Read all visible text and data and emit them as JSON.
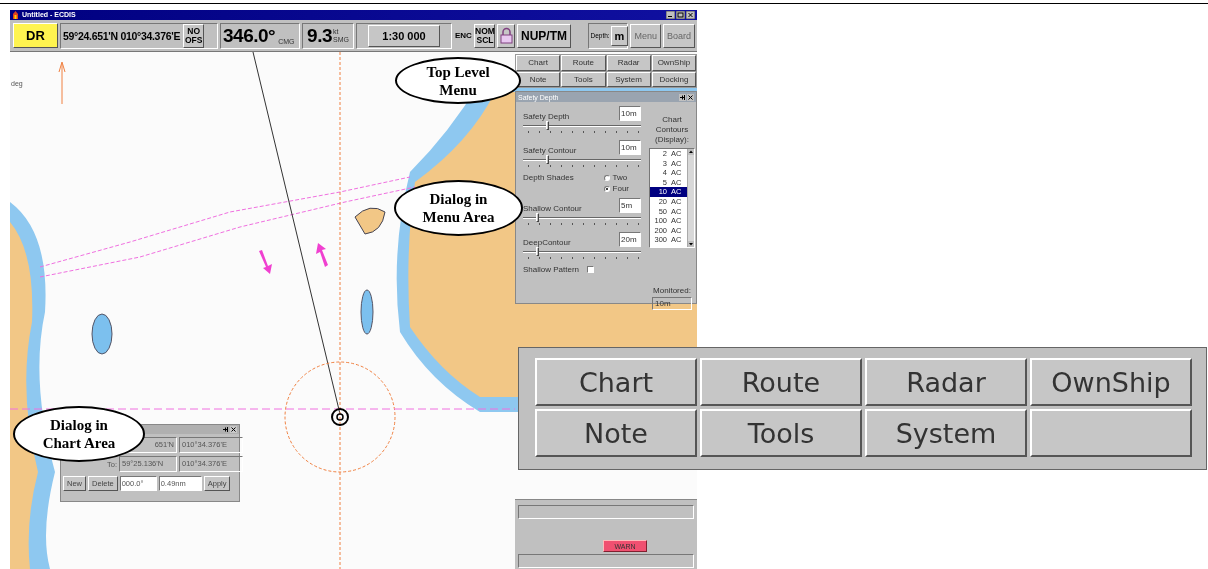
{
  "window": {
    "title": "Untitled - ECDIS"
  },
  "toolbar": {
    "mode": "DR",
    "position": "59°24.651'N 010°34.376'E",
    "offset": "NO OFS",
    "course": "346.0°",
    "course_label": "CMG",
    "speed": "9.3",
    "speed_unit": "kt",
    "speed_label": "SMG",
    "scale": "1:30 000",
    "chart_type": "ENC",
    "scale_mode": "NOM SCL",
    "orientation": "NUP/TM",
    "depth_label": "Depth:",
    "depth_unit": "m",
    "buttons": [
      "Menu",
      "Board"
    ]
  },
  "chart": {
    "kind": "picture",
    "heading_label": "deg"
  },
  "menu": {
    "buttons": [
      "Chart",
      "Route",
      "Radar",
      "OwnShip",
      "Note",
      "Tools",
      "System",
      "Docking"
    ]
  },
  "safety_depth_dialog": {
    "title": "Safety Depth",
    "controls": [
      {
        "kind": "slider",
        "label": "Safety Depth",
        "value": "10m",
        "level": 0.2
      },
      {
        "kind": "slider",
        "label": "Safety Contour",
        "value": "10m",
        "level": 0.2
      },
      {
        "kind": "radio_group",
        "label": "Depth Shades",
        "options": [
          {
            "label": "Two",
            "selected": false
          },
          {
            "label": "Four",
            "selected": true
          }
        ]
      },
      {
        "kind": "slider",
        "label": "Shallow Contour",
        "value": "5m",
        "level": 0.12
      },
      {
        "kind": "slider",
        "label": "DeepContour",
        "value": "20m",
        "level": 0.12
      },
      {
        "kind": "checkbox",
        "label": "Shallow Pattern",
        "checked": false
      }
    ],
    "contours": {
      "title": "Chart Contours (Display):",
      "items": [
        {
          "depth": "2",
          "status": "AC",
          "selected": false
        },
        {
          "depth": "3",
          "status": "AC",
          "selected": false
        },
        {
          "depth": "4",
          "status": "AC",
          "selected": false
        },
        {
          "depth": "5",
          "status": "AC",
          "selected": false
        },
        {
          "depth": "10",
          "status": "AC",
          "selected": true
        },
        {
          "depth": "20",
          "status": "AC",
          "selected": false
        },
        {
          "depth": "50",
          "status": "AC",
          "selected": false
        },
        {
          "depth": "100",
          "status": "AC",
          "selected": false
        },
        {
          "depth": "200",
          "status": "AC",
          "selected": false
        },
        {
          "depth": "300",
          "status": "AC",
          "selected": false
        }
      ]
    },
    "monitored": {
      "label": "Monitored:",
      "value": "10m"
    }
  },
  "chart_dialog": {
    "rows": [
      {
        "label": null,
        "lat": "651'N",
        "lon": "010°34.376'E"
      },
      {
        "label": "To:",
        "lat": "59°25.136'N",
        "lon": "010°34.376'E"
      }
    ],
    "buttons": [
      "New",
      "Delete"
    ],
    "fields": [
      "000.0°",
      "0.49nm"
    ],
    "apply": "Apply"
  },
  "status_panel": {
    "warning": "WARN"
  },
  "zoomed_menu": {
    "buttons": [
      "Chart",
      "Route",
      "Radar",
      "OwnShip",
      "Note",
      "Tools",
      "System"
    ]
  },
  "callouts": [
    {
      "text": "Top Level Menu"
    },
    {
      "text": "Dialog in Menu Area"
    },
    {
      "text": "Dialog in Chart Area"
    }
  ]
}
